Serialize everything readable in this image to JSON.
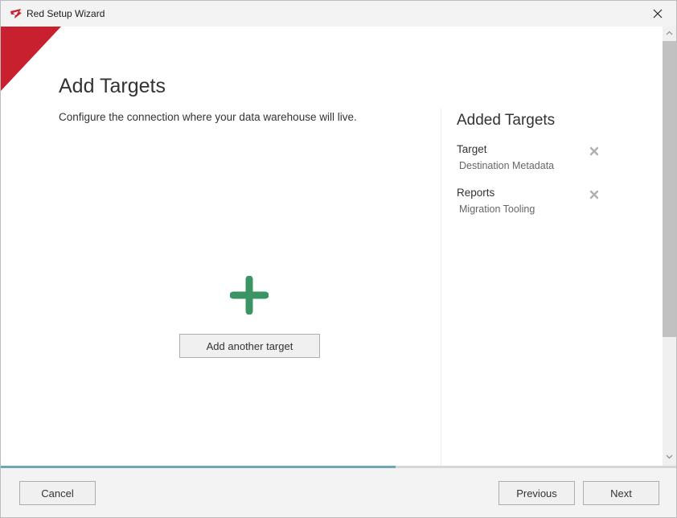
{
  "window": {
    "title": "Red Setup Wizard"
  },
  "page": {
    "title": "Add Targets",
    "subtitle": "Configure the connection where your data warehouse will live."
  },
  "added_targets": {
    "title": "Added Targets",
    "items": [
      {
        "name": "Target",
        "type": "Destination Metadata"
      },
      {
        "name": "Reports",
        "type": "Migration Tooling"
      }
    ]
  },
  "add_target": {
    "button_label": "Add another target"
  },
  "progress": {
    "fraction": 0.585
  },
  "footer": {
    "cancel_label": "Cancel",
    "previous_label": "Previous",
    "next_label": "Next"
  },
  "colors": {
    "accent_red": "#c8202f",
    "plus_green": "#3a9463",
    "progress": "#6fa8b4"
  },
  "icons": {
    "app": "red-logo-icon",
    "close": "close-icon",
    "remove": "remove-x-icon",
    "add": "plus-icon"
  }
}
